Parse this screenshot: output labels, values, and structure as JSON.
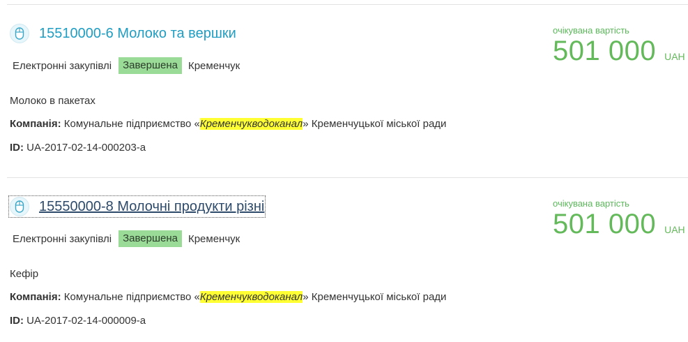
{
  "tenders": [
    {
      "title": "15510000-6 Молоко та вершки",
      "procurement_type": "Електронні закупівлі",
      "status": "Завершена",
      "city": "Кременчук",
      "description": "Молоко в пакетах",
      "company_label": "Компанія:",
      "company_prefix": "Комунальне підприємство «",
      "company_highlight": "Кременчукводоканал",
      "company_suffix": "» Кременчуцької міської ради",
      "id_label": "ID:",
      "id_value": "UA-2017-02-14-000203-a",
      "price_caption": "очікувана вартість",
      "price_amount": "501 000",
      "currency": "UAH"
    },
    {
      "title": "15550000-8 Молочні продукти різні",
      "procurement_type": "Електронні закупівлі",
      "status": "Завершена",
      "city": "Кременчук",
      "description": "Кефір",
      "company_label": "Компанія:",
      "company_prefix": "Комунальне підприємство «",
      "company_highlight": "Кременчукводоканал",
      "company_suffix": "» Кременчуцької міської ради",
      "id_label": "ID:",
      "id_value": "UA-2017-02-14-000009-a",
      "price_caption": "очікувана вартість",
      "price_amount": "501 000",
      "currency": "UAH"
    }
  ],
  "colors": {
    "link": "#1f9dc2",
    "visited_link": "#2d4a6b",
    "status_badge": "#9bdb98",
    "price": "#64b95b",
    "highlight": "#ffff33"
  }
}
